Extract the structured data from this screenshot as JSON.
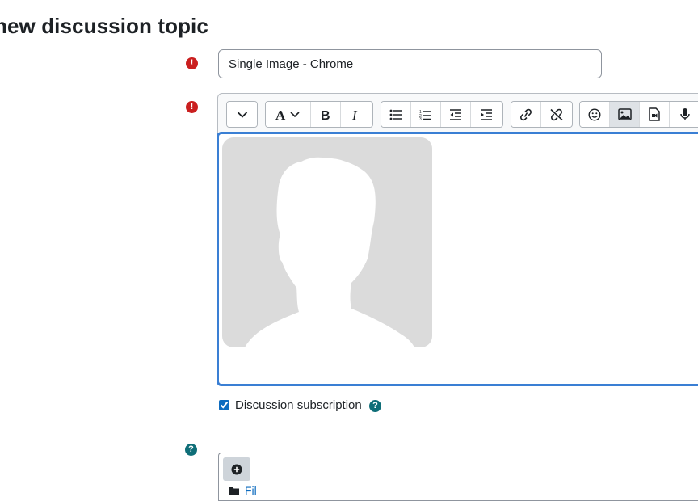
{
  "page": {
    "title": "new discussion topic"
  },
  "subject": {
    "value": "Single Image - Chrome",
    "required_icon": "exclamation-icon"
  },
  "message": {
    "required_icon": "exclamation-icon"
  },
  "toolbar": {
    "groups": [
      [
        "chevron-down-icon"
      ],
      [
        "font-size-icon",
        "bold-icon",
        "italic-icon"
      ],
      [
        "bullet-list-icon",
        "numbered-list-icon",
        "outdent-icon",
        "indent-icon"
      ],
      [
        "link-icon",
        "unlink-icon"
      ],
      [
        "emoji-icon",
        "image-icon",
        "media-icon",
        "microphone-icon"
      ]
    ],
    "active": "image-icon"
  },
  "editor_content": {
    "image": "person-silhouette-placeholder"
  },
  "subscription": {
    "label": "Discussion subscription",
    "checked": true,
    "help_icon": "help-icon"
  },
  "attachments": {
    "help_icon": "help-icon",
    "add_icon": "plus-circle-icon",
    "folder_label": "Fil"
  },
  "colors": {
    "required": "#ca1f1f",
    "help": "#0f6e78",
    "focus_border": "#3a7fd4",
    "link": "#0f6cbf",
    "placeholder_bg": "#dbdbdb"
  }
}
